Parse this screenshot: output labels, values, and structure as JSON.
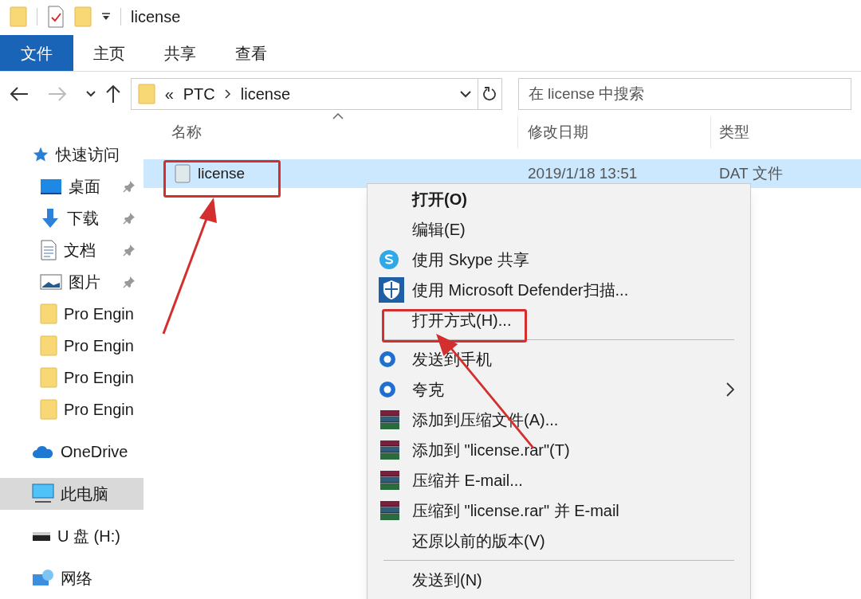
{
  "window": {
    "title": "license"
  },
  "ribbon": {
    "tabs": [
      {
        "label": "文件",
        "selected": true
      },
      {
        "label": "主页",
        "selected": false
      },
      {
        "label": "共享",
        "selected": false
      },
      {
        "label": "查看",
        "selected": false
      }
    ]
  },
  "address": {
    "path": [
      "PTC",
      "license"
    ],
    "overflow": "«",
    "search_placeholder": "在 license 中搜索"
  },
  "columns": [
    "名称",
    "修改日期",
    "类型"
  ],
  "sidebar": {
    "items": [
      {
        "kind": "quick",
        "label": "快速访问",
        "pinned": false,
        "selected": false
      },
      {
        "kind": "desktop",
        "label": "桌面",
        "pinned": true,
        "selected": false
      },
      {
        "kind": "download",
        "label": "下载",
        "pinned": true,
        "selected": false
      },
      {
        "kind": "document",
        "label": "文档",
        "pinned": true,
        "selected": false
      },
      {
        "kind": "picture",
        "label": "图片",
        "pinned": true,
        "selected": false
      },
      {
        "kind": "folder",
        "label": "Pro Engin",
        "pinned": false,
        "selected": false
      },
      {
        "kind": "folder",
        "label": "Pro Engin",
        "pinned": false,
        "selected": false
      },
      {
        "kind": "folder",
        "label": "Pro Engin",
        "pinned": false,
        "selected": false
      },
      {
        "kind": "folder",
        "label": "Pro Engin",
        "pinned": false,
        "selected": false
      },
      {
        "kind": "cloud",
        "label": "OneDrive",
        "pinned": false,
        "selected": false
      },
      {
        "kind": "pc",
        "label": "此电脑",
        "pinned": false,
        "selected": true
      },
      {
        "kind": "drive",
        "label": "U 盘 (H:)",
        "pinned": false,
        "selected": false
      },
      {
        "kind": "network",
        "label": "网络",
        "pinned": false,
        "selected": false
      }
    ]
  },
  "files": [
    {
      "name": "license",
      "modified": "2019/1/18 13:51",
      "type": "DAT 文件",
      "selected": true,
      "annotated": true
    }
  ],
  "context_menu": {
    "items": [
      {
        "kind": "plain",
        "label": "打开(O)",
        "bold": true,
        "submenu": false,
        "annotated": false
      },
      {
        "kind": "plain",
        "label": "编辑(E)",
        "bold": false,
        "submenu": false,
        "annotated": false
      },
      {
        "kind": "skype",
        "label": "使用 Skype 共享",
        "bold": false,
        "submenu": false,
        "annotated": false
      },
      {
        "kind": "defender",
        "label": "使用 Microsoft Defender扫描...",
        "bold": false,
        "submenu": false,
        "annotated": false
      },
      {
        "kind": "plain",
        "label": "打开方式(H)...",
        "bold": false,
        "submenu": false,
        "annotated": true
      },
      {
        "kind": "separator"
      },
      {
        "kind": "phone",
        "label": "发送到手机",
        "bold": false,
        "submenu": false,
        "annotated": false
      },
      {
        "kind": "phone",
        "label": "夸克",
        "bold": false,
        "submenu": true,
        "annotated": false
      },
      {
        "kind": "rar",
        "label": "添加到压缩文件(A)...",
        "bold": false,
        "submenu": false,
        "annotated": false
      },
      {
        "kind": "rar",
        "label": "添加到 \"license.rar\"(T)",
        "bold": false,
        "submenu": false,
        "annotated": false
      },
      {
        "kind": "rar",
        "label": "压缩并 E-mail...",
        "bold": false,
        "submenu": false,
        "annotated": false
      },
      {
        "kind": "rar",
        "label": "压缩到 \"license.rar\" 并 E-mail",
        "bold": false,
        "submenu": false,
        "annotated": false
      },
      {
        "kind": "plain",
        "label": "还原以前的版本(V)",
        "bold": false,
        "submenu": false,
        "annotated": false
      },
      {
        "kind": "separator"
      },
      {
        "kind": "plain",
        "label": "发送到(N)",
        "bold": false,
        "submenu": false,
        "annotated": false
      }
    ]
  }
}
